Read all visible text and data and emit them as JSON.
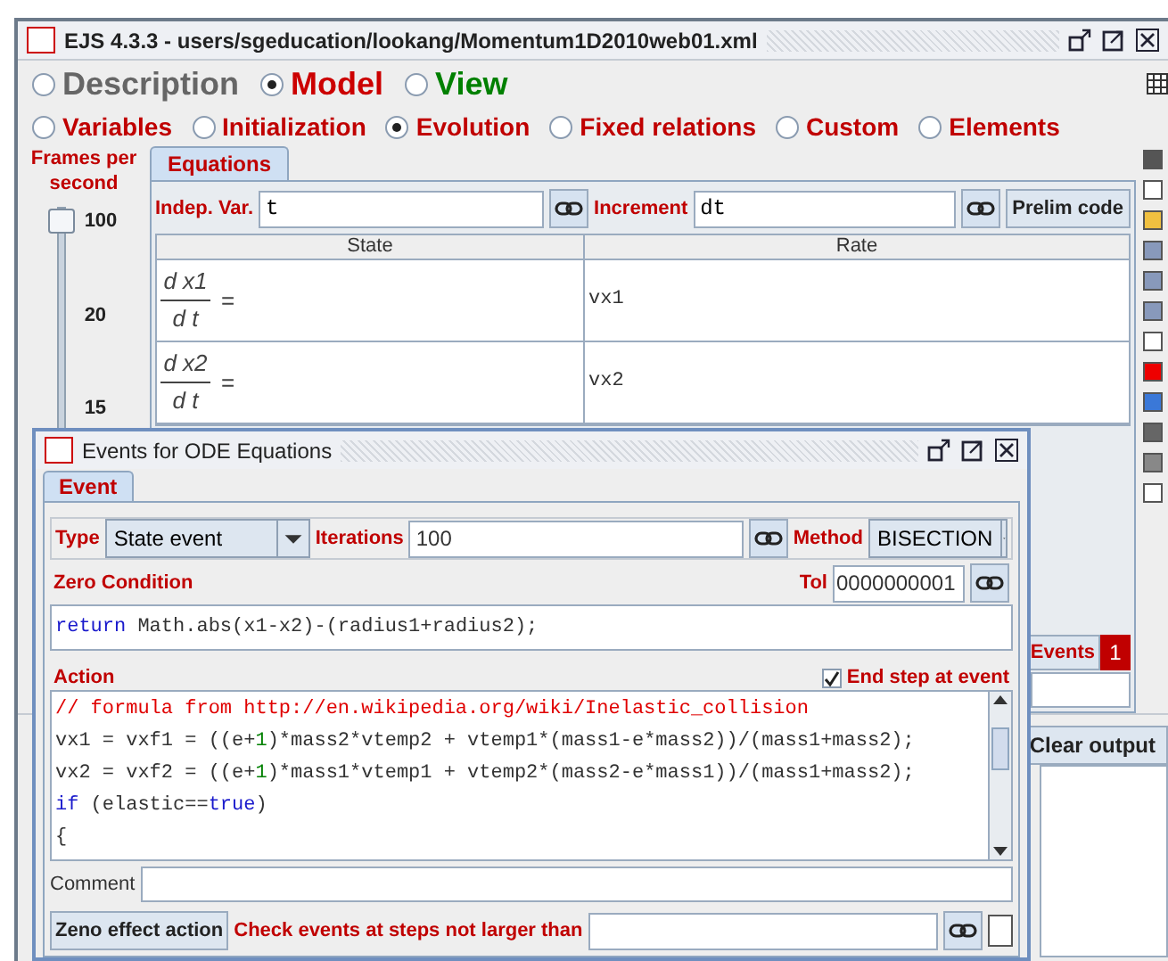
{
  "window": {
    "title": "EJS 4.3.3 - users/sgeducation/lookang/Momentum1D2010web01.xml"
  },
  "main_tabs": [
    {
      "label": "Description",
      "selected": false,
      "color": "#666666"
    },
    {
      "label": "Model",
      "selected": true,
      "color": "#cc0000"
    },
    {
      "label": "View",
      "selected": false,
      "color": "#008000"
    }
  ],
  "model_tabs": [
    {
      "label": "Variables",
      "selected": false
    },
    {
      "label": "Initialization",
      "selected": false
    },
    {
      "label": "Evolution",
      "selected": true
    },
    {
      "label": "Fixed relations",
      "selected": false
    },
    {
      "label": "Custom",
      "selected": false
    },
    {
      "label": "Elements",
      "selected": false
    }
  ],
  "fps_slider": {
    "label": "Frames per second",
    "level": 1,
    "ticks": [
      "100",
      "20",
      "15"
    ]
  },
  "equations": {
    "tab": "Equations",
    "indep_var_label": "Indep. Var.",
    "indep_var": "t",
    "increment_label": "Increment",
    "increment": "dt",
    "prelim_button": "Prelim code",
    "columns": [
      "State",
      "Rate"
    ],
    "rows": [
      {
        "numerator": "d x1",
        "denominator": "d t",
        "equals": "=",
        "rate": "vx1"
      },
      {
        "numerator": "d x2",
        "denominator": "d t",
        "equals": "=",
        "rate": "vx2"
      }
    ],
    "events_button": "Events",
    "events_count": "1"
  },
  "output": {
    "clear_button": "Clear output"
  },
  "events_dialog": {
    "title": "Events for ODE Equations",
    "tab": "Event",
    "type_label": "Type",
    "type": "State event",
    "iterations_label": "Iterations",
    "iterations": "100",
    "method_label": "Method",
    "method": "BISECTION",
    "zero_condition_label": "Zero Condition",
    "tol_label": "Tol",
    "tol": "0000000001",
    "zero_condition_code": [
      {
        "kind": "keyword",
        "text": "return"
      },
      {
        "kind": "plain",
        "text": " Math.abs(x1-x2)-(radius1+radius2);"
      }
    ],
    "action_label": "Action",
    "end_step": {
      "label": "End step at event",
      "checked": true
    },
    "action_code": [
      [
        {
          "kind": "comment",
          "text": "// formula from http://en.wikipedia.org/wiki/Inelastic_collision"
        }
      ],
      [
        {
          "kind": "plain",
          "text": "vx1 = vxf1 = ((e+"
        },
        {
          "kind": "number",
          "text": "1"
        },
        {
          "kind": "plain",
          "text": ")*mass2*vtemp2 + vtemp1*(mass1-e*mass2))/(mass1+mass2);"
        }
      ],
      [
        {
          "kind": "plain",
          "text": "vx2 = vxf2 = ((e+"
        },
        {
          "kind": "number",
          "text": "1"
        },
        {
          "kind": "plain",
          "text": ")*mass1*vtemp1 + vtemp2*(mass2-e*mass1))/(mass1+mass2);"
        }
      ],
      [
        {
          "kind": "keyword",
          "text": "if"
        },
        {
          "kind": "plain",
          "text": " (elastic=="
        },
        {
          "kind": "keyword",
          "text": "true"
        },
        {
          "kind": "plain",
          "text": ")"
        }
      ],
      [
        {
          "kind": "plain",
          "text": "{"
        }
      ]
    ],
    "comment_label": "Comment",
    "zeno_button": "Zeno effect action",
    "check_label": "Check events at steps not larger than"
  }
}
